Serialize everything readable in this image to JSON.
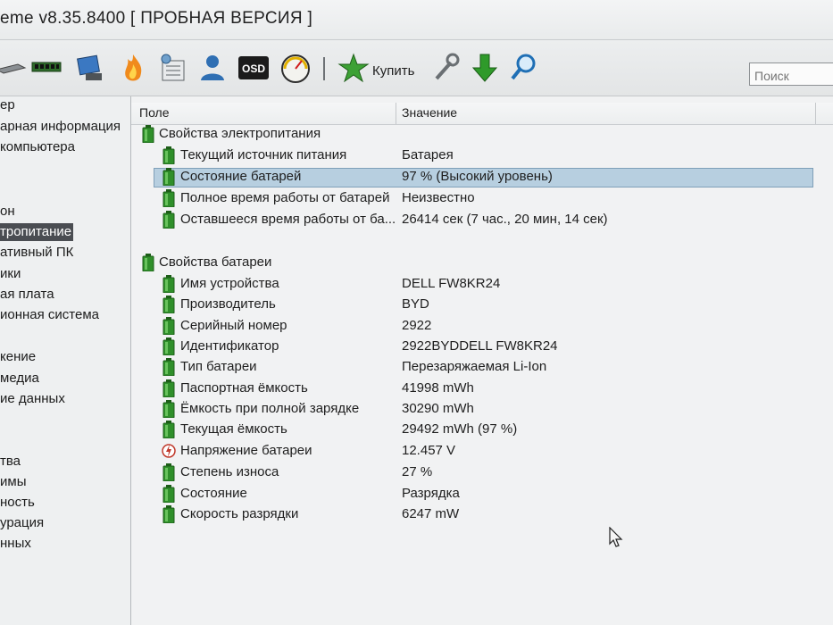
{
  "window": {
    "title": "eme v8.35.8400  [ ПРОБНАЯ ВЕРСИЯ ]"
  },
  "toolbar": {
    "icons": [
      "network-icon",
      "memory-icon",
      "device-icon",
      "flame-icon",
      "task-scheduler-icon",
      "user-icon",
      "osd-icon",
      "gauge-icon",
      "buy-star-icon",
      "tools-icon",
      "download-icon",
      "search-magnifier-icon"
    ],
    "buy_label": "Купить",
    "search_placeholder": "Поиск",
    "osd_text": "OSD"
  },
  "nav": {
    "items": [
      {
        "label": "ер"
      },
      {
        "label": "арная информация"
      },
      {
        "label": "компьютера"
      },
      {
        "label": "он"
      },
      {
        "label": "тропитание",
        "selected": true
      },
      {
        "label": "ативный ПК"
      },
      {
        "label": "ики"
      },
      {
        "label": "ая плата"
      },
      {
        "label": "ионная система"
      },
      {
        "label": "кение"
      },
      {
        "label": "медиа"
      },
      {
        "label": "ие данных"
      },
      {
        "label": "тва"
      },
      {
        "label": "имы"
      },
      {
        "label": "ность"
      },
      {
        "label": "урация"
      },
      {
        "label": "нных"
      }
    ]
  },
  "table": {
    "columns": {
      "field": "Поле",
      "value": "Значение"
    },
    "groups": [
      {
        "label": "Свойства электропитания",
        "rows": [
          {
            "label": "Текущий источник питания",
            "value": "Батарея"
          },
          {
            "label": "Состояние батарей",
            "value": "97 % (Высокий уровень)",
            "selected": true
          },
          {
            "label": "Полное время работы от батарей",
            "value": "Неизвестно"
          },
          {
            "label": "Оставшееся время работы от ба...",
            "value": "26414 сек (7 час., 20 мин, 14 сек)"
          }
        ]
      },
      {
        "label": "Свойства батареи",
        "rows": [
          {
            "label": "Имя устройства",
            "value": "DELL FW8KR24"
          },
          {
            "label": "Производитель",
            "value": "BYD"
          },
          {
            "label": "Серийный номер",
            "value": "2922"
          },
          {
            "label": "Идентификатор",
            "value": "2922BYDDELL FW8KR24"
          },
          {
            "label": "Тип батареи",
            "value": "Перезаряжаемая Li-Ion"
          },
          {
            "label": "Паспортная ёмкость",
            "value": "41998 mWh"
          },
          {
            "label": "Ёмкость при полной зарядке",
            "value": "30290 mWh"
          },
          {
            "label": "Текущая ёмкость",
            "value": "29492 mWh  (97 %)"
          },
          {
            "label": "Напряжение батареи",
            "value": "12.457 V",
            "icon": "voltage-icon"
          },
          {
            "label": "Степень износа",
            "value": "27 %"
          },
          {
            "label": "Состояние",
            "value": "Разрядка"
          },
          {
            "label": "Скорость разрядки",
            "value": "6247 mW"
          }
        ]
      }
    ]
  },
  "colors": {
    "selection": "#b7cfe0",
    "nav_selected": "#4a4d52",
    "battery_green": "#2f8f2a"
  }
}
